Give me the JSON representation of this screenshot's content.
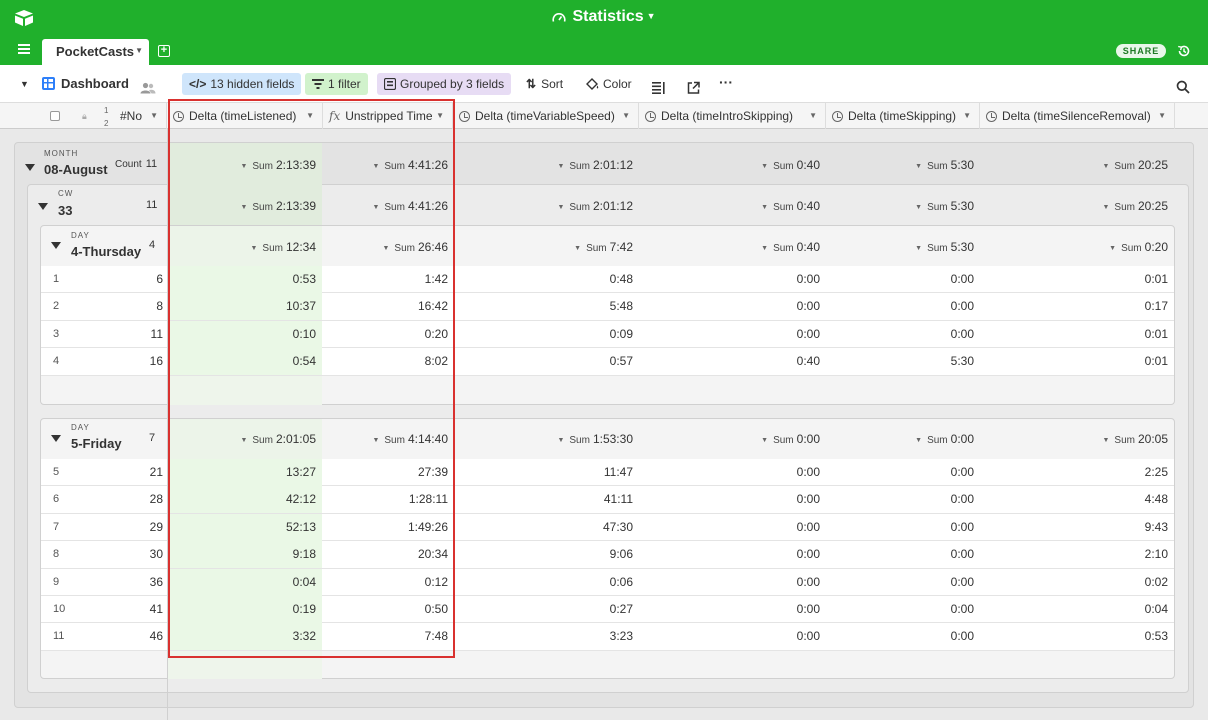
{
  "app": {
    "title": "Statistics",
    "tab_label": "PocketCasts",
    "share_label": "SHARE"
  },
  "toolbar": {
    "view_name": "Dashboard",
    "hidden_fields": "13 hidden fields",
    "filter": "1 filter",
    "grouped": "Grouped by 3 fields",
    "sort": "Sort",
    "color": "Color"
  },
  "columns": [
    {
      "label": "#No"
    },
    {
      "label": "Delta (timeListened)",
      "icon": "clock-icon"
    },
    {
      "label": "Unstripped Time",
      "icon": "formula-icon"
    },
    {
      "label": "Delta (timeVariableSpeed)",
      "icon": "clock-icon"
    },
    {
      "label": "Delta (timeIntroSkipping)",
      "icon": "clock-icon"
    },
    {
      "label": "Delta (timeSkipping)",
      "icon": "clock-icon"
    },
    {
      "label": "Delta (timeSilenceRemoval)",
      "icon": "clock-icon"
    }
  ],
  "sum_label": "Sum",
  "count_label": "Count",
  "groups": {
    "month": {
      "type": "MONTH",
      "name": "08-August",
      "count": "11",
      "sums": [
        "2:13:39",
        "4:41:26",
        "2:01:12",
        "0:40",
        "5:30",
        "20:25"
      ]
    },
    "cw": {
      "type": "CW",
      "name": "33",
      "count": "11",
      "sums": [
        "2:13:39",
        "4:41:26",
        "2:01:12",
        "0:40",
        "5:30",
        "20:25"
      ]
    },
    "day1": {
      "type": "DAY",
      "name": "4-Thursday",
      "count": "4",
      "sums": [
        "12:34",
        "26:46",
        "7:42",
        "0:40",
        "5:30",
        "0:20"
      ],
      "rows": [
        {
          "idx": "1",
          "no": "6",
          "vals": [
            "0:53",
            "1:42",
            "0:48",
            "0:00",
            "0:00",
            "0:01"
          ]
        },
        {
          "idx": "2",
          "no": "8",
          "vals": [
            "10:37",
            "16:42",
            "5:48",
            "0:00",
            "0:00",
            "0:17"
          ]
        },
        {
          "idx": "3",
          "no": "11",
          "vals": [
            "0:10",
            "0:20",
            "0:09",
            "0:00",
            "0:00",
            "0:01"
          ]
        },
        {
          "idx": "4",
          "no": "16",
          "vals": [
            "0:54",
            "8:02",
            "0:57",
            "0:40",
            "5:30",
            "0:01"
          ]
        }
      ]
    },
    "day2": {
      "type": "DAY",
      "name": "5-Friday",
      "count": "7",
      "sums": [
        "2:01:05",
        "4:14:40",
        "1:53:30",
        "0:00",
        "0:00",
        "20:05"
      ],
      "rows": [
        {
          "idx": "5",
          "no": "21",
          "vals": [
            "13:27",
            "27:39",
            "11:47",
            "0:00",
            "0:00",
            "2:25"
          ]
        },
        {
          "idx": "6",
          "no": "28",
          "vals": [
            "42:12",
            "1:28:11",
            "41:11",
            "0:00",
            "0:00",
            "4:48"
          ]
        },
        {
          "idx": "7",
          "no": "29",
          "vals": [
            "52:13",
            "1:49:26",
            "47:30",
            "0:00",
            "0:00",
            "9:43"
          ]
        },
        {
          "idx": "8",
          "no": "30",
          "vals": [
            "9:18",
            "20:34",
            "9:06",
            "0:00",
            "0:00",
            "2:10"
          ]
        },
        {
          "idx": "9",
          "no": "36",
          "vals": [
            "0:04",
            "0:12",
            "0:06",
            "0:00",
            "0:00",
            "0:02"
          ]
        },
        {
          "idx": "10",
          "no": "41",
          "vals": [
            "0:19",
            "0:50",
            "0:27",
            "0:00",
            "0:00",
            "0:04"
          ]
        },
        {
          "idx": "11",
          "no": "46",
          "vals": [
            "3:32",
            "7:48",
            "3:23",
            "0:00",
            "0:00",
            "0:53"
          ]
        }
      ]
    }
  },
  "colors": {
    "brand": "#20b02c",
    "highlight_border": "#d9312f",
    "highlight_cell": "#eaf8e6"
  }
}
